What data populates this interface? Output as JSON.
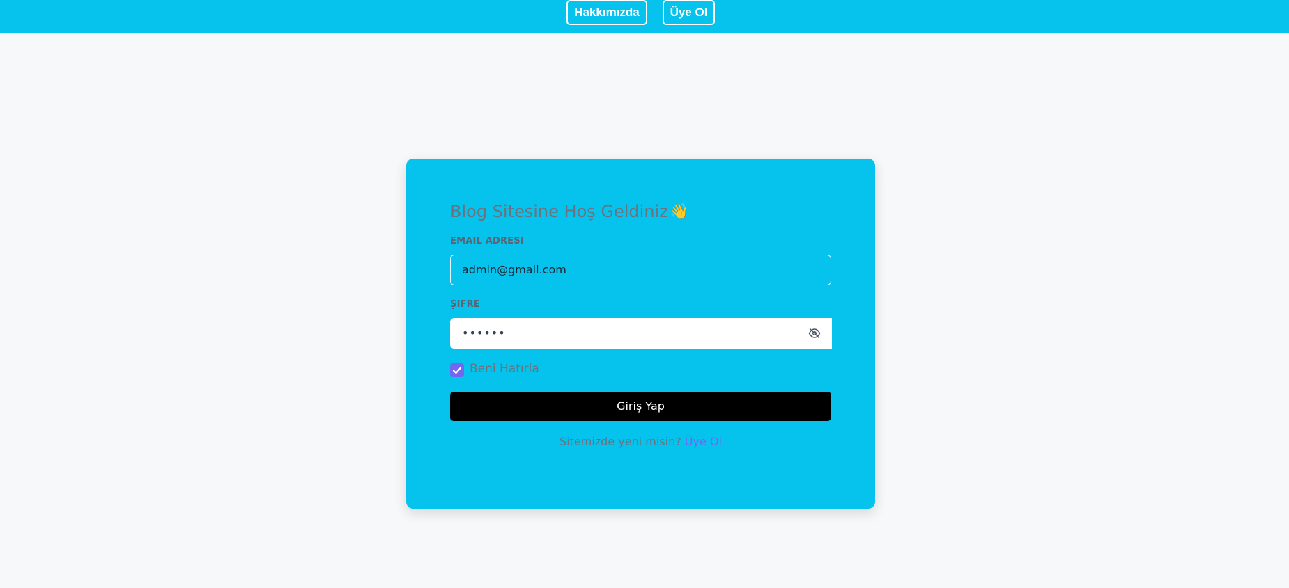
{
  "nav": {
    "about_label": "Hakkımızda",
    "signup_label": "Üye Ol"
  },
  "login": {
    "title": "Blog Sitesine Hoş Geldiniz",
    "email_label": "EMAIL ADRESI",
    "email_value": "admin@gmail.com",
    "password_label": "ŞIFRE",
    "password_value": "••••••",
    "remember_label": "Beni Hatırla",
    "remember_checked": true,
    "submit_label": "Giriş Yap",
    "footer_prompt": "Sitemizde yeni misin?",
    "footer_link": "Üye Ol"
  },
  "icons": {
    "wave": "waving-hand-emoji",
    "password_toggle": "eye-off-icon",
    "checkbox": "check-icon"
  },
  "colors": {
    "brand_cyan": "#05c3ec",
    "accent_purple": "#7367f0",
    "button_black": "#000000"
  }
}
